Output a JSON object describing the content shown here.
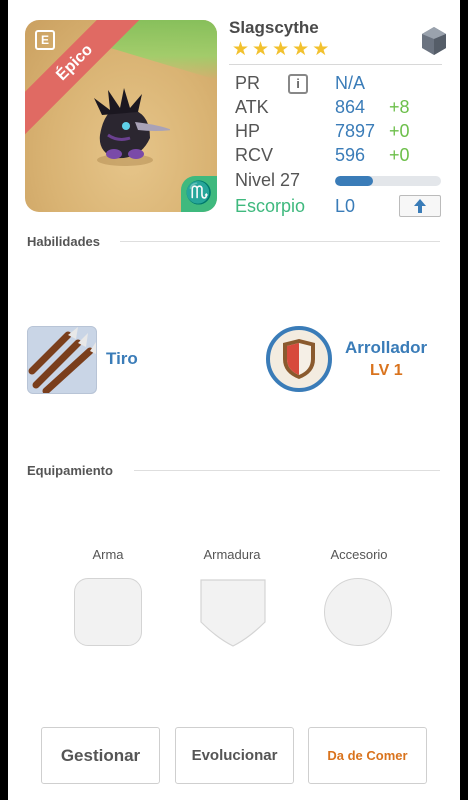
{
  "monster": {
    "name": "Slagscythe",
    "stars": 5,
    "rarity": "Épico",
    "element_icon": "gray-gem-icon",
    "zodiac_symbol": "♏"
  },
  "stats": {
    "pr": {
      "label": "PR",
      "value": "N/A"
    },
    "atk": {
      "label": "ATK",
      "value": "864",
      "bonus": "+8"
    },
    "hp": {
      "label": "HP",
      "value": "7897",
      "bonus": "+0"
    },
    "rcv": {
      "label": "RCV",
      "value": "596",
      "bonus": "+0"
    },
    "level": {
      "label": "Nivel 27",
      "progress": 0.36
    },
    "zodiac": {
      "label": "Escorpio",
      "value": "L0"
    }
  },
  "skills": {
    "title": "Habilidades",
    "active": {
      "name": "Tiro",
      "icon": "arrows-icon"
    },
    "passive": {
      "name": "Arrollador",
      "level": "LV 1",
      "icon": "shield-crest-icon"
    }
  },
  "equipment": {
    "title": "Equipamiento",
    "slots": [
      {
        "label": "Arma"
      },
      {
        "label": "Armadura"
      },
      {
        "label": "Accesorio"
      }
    ]
  },
  "actions": {
    "manage": "Gestionar",
    "evolve": "Evolucionar",
    "feed": "Da de Comer"
  },
  "colors": {
    "accent_blue": "#3a7cb8",
    "bonus_green": "#6cbf4a",
    "zodiac_green": "#3fb97e",
    "rarity_red": "#e06a63",
    "feed_orange": "#d9731d",
    "star_gold": "#f2c12e"
  }
}
